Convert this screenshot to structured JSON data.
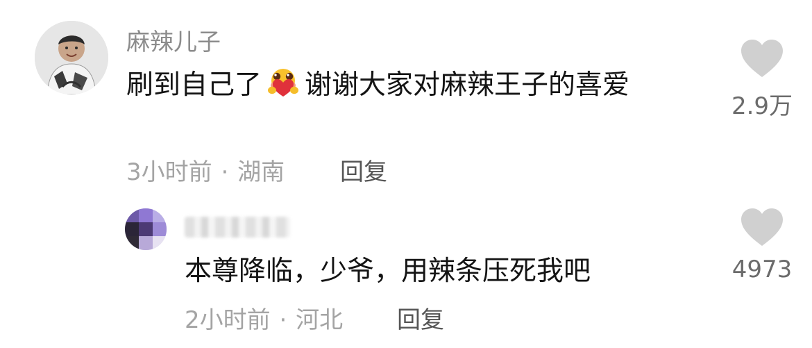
{
  "comments": [
    {
      "username": "麻辣儿子",
      "text_before_emoji": "刷到自己了",
      "emoji": "hugging-heart-emoji",
      "text_after_emoji": "谢谢大家对麻辣王子的喜爱",
      "time": "3小时前",
      "location": "湖南",
      "meta_separator": "·",
      "reply_label": "回复",
      "like_count": "2.9万"
    },
    {
      "username": "",
      "text": "本尊降临，少爷，用辣条压死我吧",
      "time": "2小时前",
      "location": "河北",
      "meta_separator": "·",
      "reply_label": "回复",
      "like_count": "4973"
    }
  ],
  "colors": {
    "username": "#8c8c8c",
    "body_text": "#141414",
    "meta": "#a4a4a4",
    "reply": "#555555",
    "heart": "#d0d0d0",
    "like_count": "#6b6b6b"
  },
  "icons": {
    "like": "heart-icon"
  }
}
